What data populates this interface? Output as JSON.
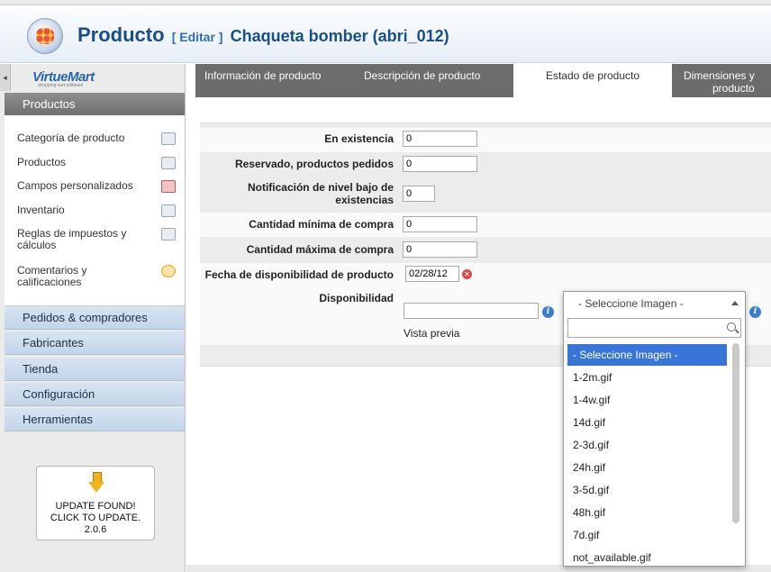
{
  "header": {
    "title": "Producto",
    "edit_label": "[ Editar ]",
    "product_name": "Chaqueta bomber (abri_012)"
  },
  "sidebar": {
    "logo_text": "VirtueMart",
    "logo_tagline": "shopping cart software",
    "section_title": "Productos",
    "items": [
      {
        "label": "Categoría de producto",
        "icon": "category-icon"
      },
      {
        "label": "Productos",
        "icon": "products-icon"
      },
      {
        "label": "Campos personalizados",
        "icon": "custom-fields-icon"
      },
      {
        "label": "Inventario",
        "icon": "inventory-icon"
      },
      {
        "label": "Reglas de impuestos y cálculos",
        "icon": "tax-rules-icon"
      },
      {
        "label": "Comentarios y calificaciones",
        "icon": "reviews-icon"
      }
    ],
    "accordion": [
      "Pedidos & compradores",
      "Fabricantes",
      "Tienda",
      "Configuración",
      "Herramientas"
    ],
    "update": {
      "line1": "UPDATE FOUND!",
      "line2": "CLICK TO UPDATE.",
      "version": "2.0.6"
    }
  },
  "tabs": [
    {
      "label": "Información de producto",
      "active": false
    },
    {
      "label": "Descripción de producto",
      "active": false
    },
    {
      "label": "Estado de producto",
      "active": true
    },
    {
      "label": "Dimensiones y\nproducto",
      "active": false
    }
  ],
  "form": {
    "in_stock": {
      "label": "En existencia",
      "value": "0"
    },
    "reserved": {
      "label": "Reservado, productos pedidos",
      "value": "0"
    },
    "low_stock": {
      "label": "Notificación de nivel bajo de existencias",
      "value": "0"
    },
    "min_qty": {
      "label": "Cantidad mínima de compra",
      "value": "0"
    },
    "max_qty": {
      "label": "Cantidad máxima de compra",
      "value": "0"
    },
    "avail_date": {
      "label": "Fecha de disponibilidad de producto",
      "value": "02/28/12"
    },
    "availability": {
      "label": "Disponibilidad",
      "value": "",
      "preview_label": "Vista previa"
    }
  },
  "image_select": {
    "selected": "- Seleccione Imagen -",
    "search_value": "",
    "options": [
      "- Seleccione Imagen -",
      "1-2m.gif",
      "1-4w.gif",
      "14d.gif",
      "2-3d.gif",
      "24h.gif",
      "3-5d.gif",
      "48h.gif",
      "7d.gif",
      "not_available.gif"
    ]
  },
  "colors": {
    "accent": "#1a4f86",
    "selection": "#3875d7",
    "tab_bar": "#6c6c6c"
  }
}
